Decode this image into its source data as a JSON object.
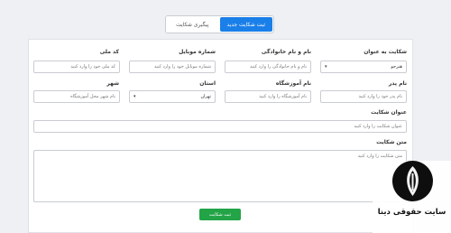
{
  "tabs": {
    "follow": "پیگیری شکایت",
    "new": "ثبت شکایت جدید"
  },
  "form": {
    "complaint_about": {
      "label": "شکایت به عنوان",
      "value": "هنرجو"
    },
    "fullname": {
      "label": "نام و نام خانوادگی",
      "placeholder": "نام و نام خانوادگی را وارد کنید"
    },
    "mobile": {
      "label": "شماره موبایل",
      "placeholder": "شماره موبایل خود را وارد کنید"
    },
    "national_code": {
      "label": "کد ملی",
      "placeholder": "کد ملی خود را وارد کنید"
    },
    "father_name": {
      "label": "نام پدر",
      "placeholder": "نام پدر خود را وارد کنید"
    },
    "school_name": {
      "label": "نام آموزشگاه",
      "placeholder": "نام آموزشگاه را وارد کنید"
    },
    "province": {
      "label": "استان",
      "value": "تهران"
    },
    "city": {
      "label": "شهر",
      "placeholder": "نام شهر محل آموزشگاه"
    },
    "subject": {
      "label": "عنوان شکایت",
      "placeholder": "عنوان شکایت را وارد کنید"
    },
    "body": {
      "label": "متن شکایت",
      "placeholder": "متن شکایت را وارد کنید"
    },
    "submit": "ثبت شکایت"
  },
  "brand": {
    "name": "سایت حقوقی دینا"
  }
}
